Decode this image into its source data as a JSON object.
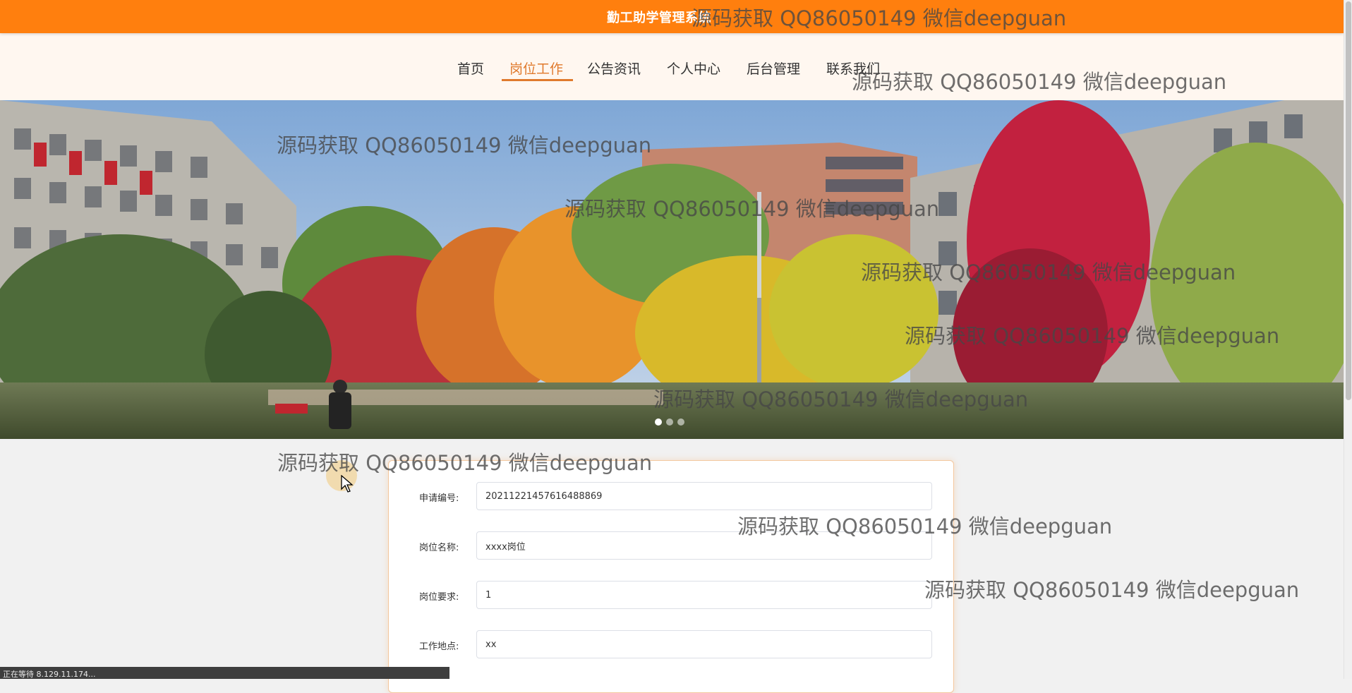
{
  "header": {
    "site_title": "勤工助学管理系统"
  },
  "nav": {
    "items": [
      {
        "label": "首页"
      },
      {
        "label": "岗位工作"
      },
      {
        "label": "公告资讯"
      },
      {
        "label": "个人中心"
      },
      {
        "label": "后台管理"
      },
      {
        "label": "联系我们"
      }
    ],
    "active_label": "岗位工作"
  },
  "banner": {
    "slide_count": 3,
    "active_slide": 1
  },
  "form": {
    "fields": [
      {
        "label": "申请编号:",
        "value": "20211221457616488869"
      },
      {
        "label": "岗位名称:",
        "value": "xxxx岗位"
      },
      {
        "label": "岗位要求:",
        "value": "1"
      },
      {
        "label": "工作地点:",
        "value": "xx"
      }
    ]
  },
  "status_bar": {
    "text": "正在等待 8.129.11.174..."
  },
  "watermark": {
    "text": "源码获取 QQ86050149 微信deepguan"
  },
  "colors": {
    "accent": "#ff7f0e",
    "nav_active": "#e07a2d",
    "nav_background": "#fff7f0"
  }
}
